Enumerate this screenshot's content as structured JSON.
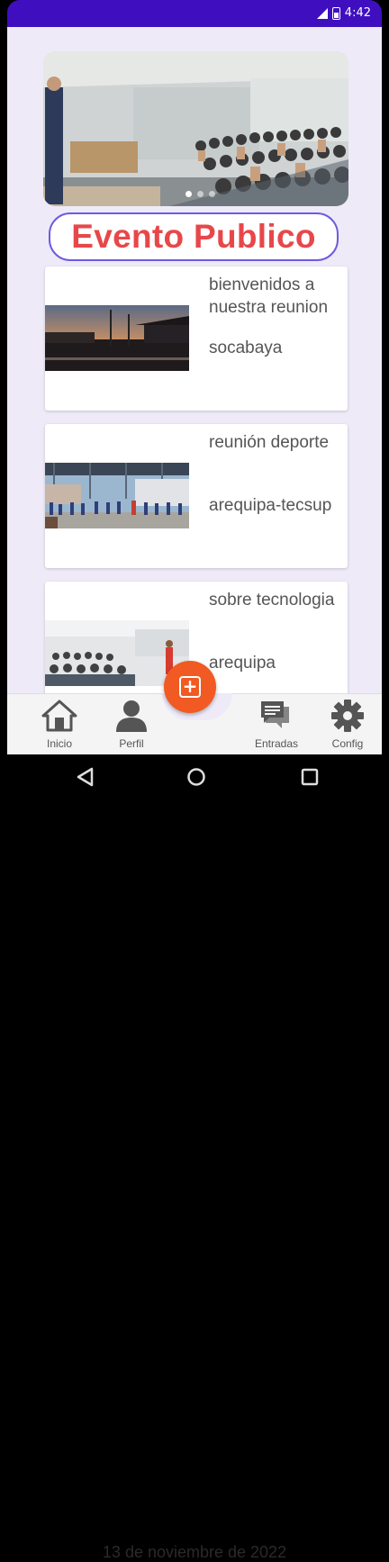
{
  "status_bar": {
    "time": "4:42"
  },
  "hero": {
    "slide_count": 3,
    "active_slide": 1
  },
  "title": "Evento Publico",
  "events": [
    {
      "title": "bienvenidos a nuestra reunion",
      "place": "socabaya",
      "image": "sunset-street"
    },
    {
      "title": "reunión deporte",
      "place": "arequipa-tecsup",
      "image": "sports-court"
    },
    {
      "title": "sobre tecnologia",
      "place": "arequipa",
      "image": "conference-room"
    }
  ],
  "fab": {
    "icon": "add-icon"
  },
  "bottom_nav": {
    "items": [
      {
        "label": "Inicio",
        "icon": "home-icon"
      },
      {
        "label": "Perfil",
        "icon": "person-icon"
      },
      {
        "label": "Entradas",
        "icon": "chat-icon"
      },
      {
        "label": "Config",
        "icon": "gear-icon"
      }
    ]
  },
  "colors": {
    "accent": "#3f0fbf",
    "title": "#e8474a",
    "fab": "#f15a22",
    "background": "#eeeaf8"
  },
  "behind_text": "13 de noviembre de 2022"
}
